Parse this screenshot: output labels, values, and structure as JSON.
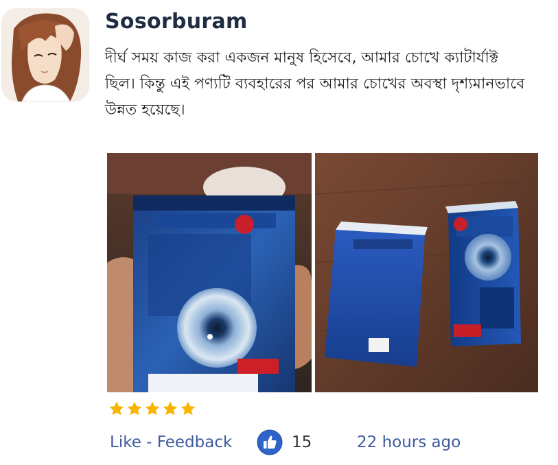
{
  "review": {
    "username": "Sosorburam",
    "text": " দীর্ঘ সময় কাজ করা একজন মানুষ হিসেবে, আমার চোখে ক্যাটার্যাক্ট ছিল। কিন্তু এই পণ্যটি ব্যবহারের পর আমার চোখের অবস্থা দৃশ্যমানভাবে উন্নত হয়েছে।",
    "rating": 5,
    "rating_max": 5,
    "like_label": "Like",
    "separator": " - ",
    "feedback_label": "Feedback",
    "like_count": "15",
    "timestamp": "22 hours ago"
  },
  "icons": {
    "avatar": "avatar",
    "star": "star-icon",
    "thumb": "thumbs-up-icon"
  },
  "colors": {
    "username": "#1f2d43",
    "link": "#3f5aa0",
    "star": "#f7b500",
    "thumb_bg": "#2f63c8"
  }
}
